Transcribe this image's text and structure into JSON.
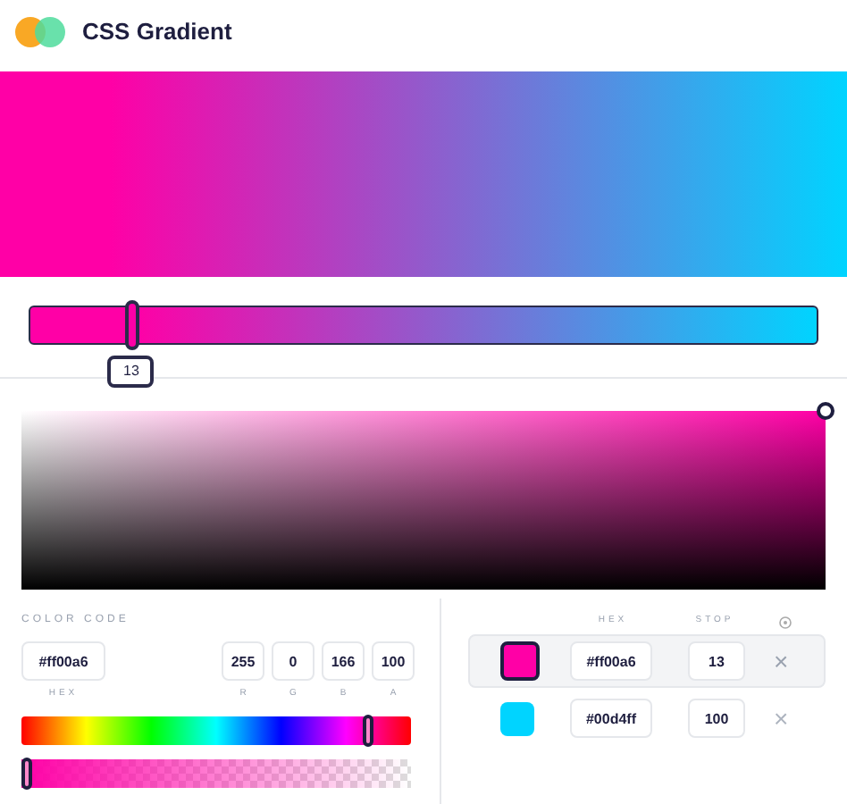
{
  "app": {
    "title": "CSS Gradient"
  },
  "gradient_bar": {
    "handle_label": "13",
    "level": 0.13
  },
  "color_code": {
    "label": "COLOR CODE",
    "hex": {
      "value": "#ff00a6",
      "label": "HEX"
    },
    "channels": [
      {
        "value": "255",
        "label": "R"
      },
      {
        "value": "0",
        "label": "G"
      },
      {
        "value": "166",
        "label": "B"
      },
      {
        "value": "100",
        "label": "A"
      }
    ],
    "hue_slider": {
      "level": 0.89
    },
    "alpha_slider": {
      "level": 0
    }
  },
  "stops": {
    "columns": [
      "HEX",
      "STOP"
    ],
    "rows": [
      {
        "color": "#ff00a6",
        "hex": "#ff00a6",
        "stop": "13",
        "selected": true,
        "remove": "×"
      },
      {
        "color": "#00d4ff",
        "hex": "#00d4ff",
        "stop": "100",
        "selected": false,
        "remove": "×"
      }
    ]
  }
}
